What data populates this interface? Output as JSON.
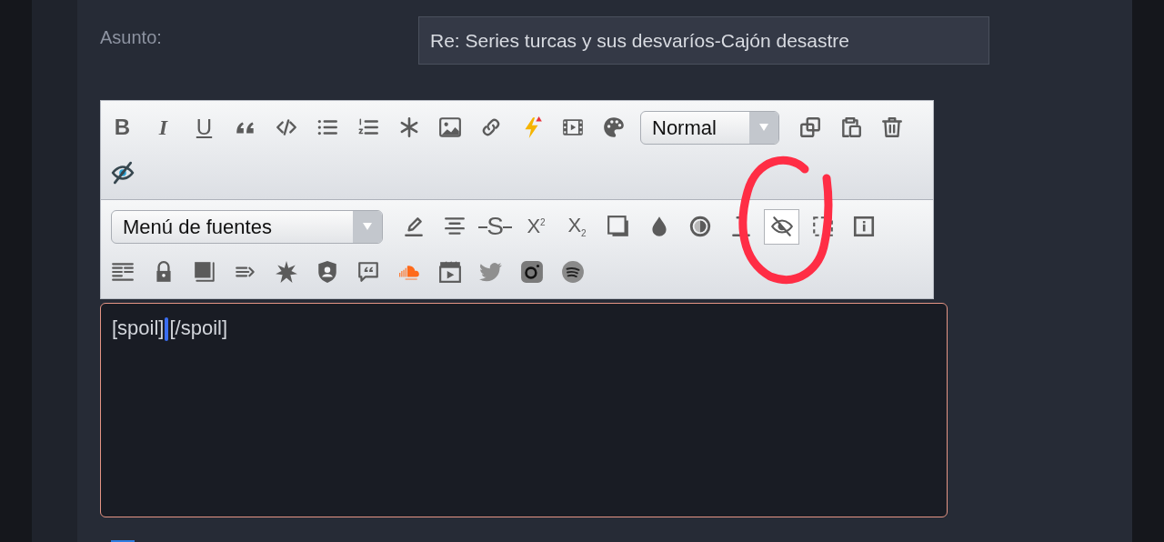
{
  "subject": {
    "label": "Asunto:",
    "value": "Re: Series turcas y sus desvaríos-Cajón desastre"
  },
  "toolbars": [
    {
      "rows": [
        [
          {
            "kind": "glyph",
            "label": "B",
            "selected": false
          },
          {
            "kind": "glyph",
            "label": "I",
            "selected": false
          },
          {
            "kind": "glyph",
            "label": "U",
            "selected": false
          },
          {
            "kind": "icon",
            "selected": false
          },
          {
            "kind": "icon",
            "selected": false
          },
          {
            "kind": "icon",
            "selected": false
          },
          {
            "kind": "icon",
            "selected": false
          },
          {
            "kind": "icon",
            "selected": false
          },
          {
            "kind": "icon",
            "selected": false
          },
          {
            "kind": "icon",
            "selected": false
          },
          {
            "kind": "icon",
            "selected": false
          },
          {
            "kind": "icon",
            "selected": false
          },
          {
            "kind": "icon",
            "selected": false
          },
          {
            "kind": "dropdown",
            "value": "Normal"
          },
          {
            "kind": "icon",
            "selected": false
          },
          {
            "kind": "icon",
            "selected": false
          },
          {
            "kind": "icon",
            "selected": false
          }
        ],
        [
          {
            "kind": "icon",
            "selected": false
          }
        ]
      ]
    },
    {
      "rows": [
        [
          {
            "kind": "dropdown",
            "value": "Menú de fuentes"
          },
          {
            "kind": "icon",
            "selected": false
          },
          {
            "kind": "icon",
            "selected": false
          },
          {
            "kind": "glyph",
            "label": "S",
            "selected": false
          },
          {
            "kind": "glyph",
            "label": "X$^{2}$",
            "selected": false
          },
          {
            "kind": "glyph",
            "label": "X$_{2}$",
            "selected": false
          },
          {
            "kind": "icon",
            "selected": false
          },
          {
            "kind": "icon",
            "selected": false
          },
          {
            "kind": "icon",
            "selected": false
          },
          {
            "kind": "icon",
            "selected": false
          },
          {
            "kind": "icon",
            "selected": true
          },
          {
            "kind": "icon",
            "selected": false
          },
          {
            "kind": "icon",
            "selected": false
          }
        ],
        [
          {
            "kind": "icon",
            "selected": false
          },
          {
            "kind": "icon",
            "selected": false
          },
          {
            "kind": "icon",
            "selected": false
          },
          {
            "kind": "icon",
            "selected": false
          },
          {
            "kind": "icon",
            "selected": false
          },
          {
            "kind": "icon",
            "selected": false
          },
          {
            "kind": "icon",
            "selected": false
          },
          {
            "kind": "icon",
            "selected": false
          },
          {
            "kind": "icon",
            "selected": false
          },
          {
            "kind": "icon",
            "selected": false
          },
          {
            "kind": "icon",
            "selected": false
          },
          {
            "kind": "icon",
            "selected": false
          }
        ]
      ]
    }
  ],
  "message": {
    "text_before_cursor": "[spoil]",
    "text_after_cursor": "[/spoil]"
  }
}
